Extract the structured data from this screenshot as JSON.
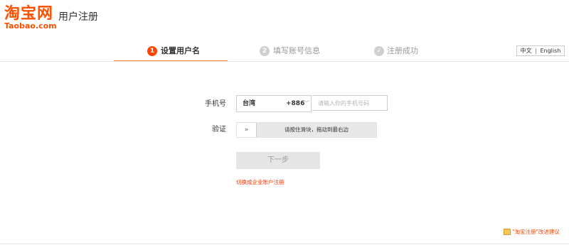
{
  "brand": {
    "logo_cn": "淘宝网",
    "logo_en": "Taobao.com",
    "color": "#ff5000"
  },
  "header": {
    "title": "用户注册"
  },
  "steps": [
    {
      "number": "1",
      "label": "设置用户名",
      "state": "active"
    },
    {
      "number": "2",
      "label": "填写账号信息",
      "state": "inactive"
    },
    {
      "number": "✓",
      "label": "注册成功",
      "state": "inactive"
    }
  ],
  "language": {
    "chinese": "中文",
    "separator": "|",
    "english": "English"
  },
  "form": {
    "phone_label": "手机号",
    "country_name": "台湾",
    "country_code": "+886",
    "country_chevron": "﹀",
    "phone_placeholder": "请输入你的手机号码",
    "verify_label": "验证",
    "slider_handle": "»",
    "slider_text": "请按住滑块，拖动到最右边",
    "next_button": "下一步",
    "enterprise_link": "切换成企业账户注册"
  },
  "footer": {
    "feedback": "\"淘宝注册\"改进建议",
    "feedback_icon": "feedback-icon"
  },
  "colors": {
    "accent": "#ff4400",
    "step_bar": "#ff7f41",
    "inactive": "#cfcfcf"
  }
}
